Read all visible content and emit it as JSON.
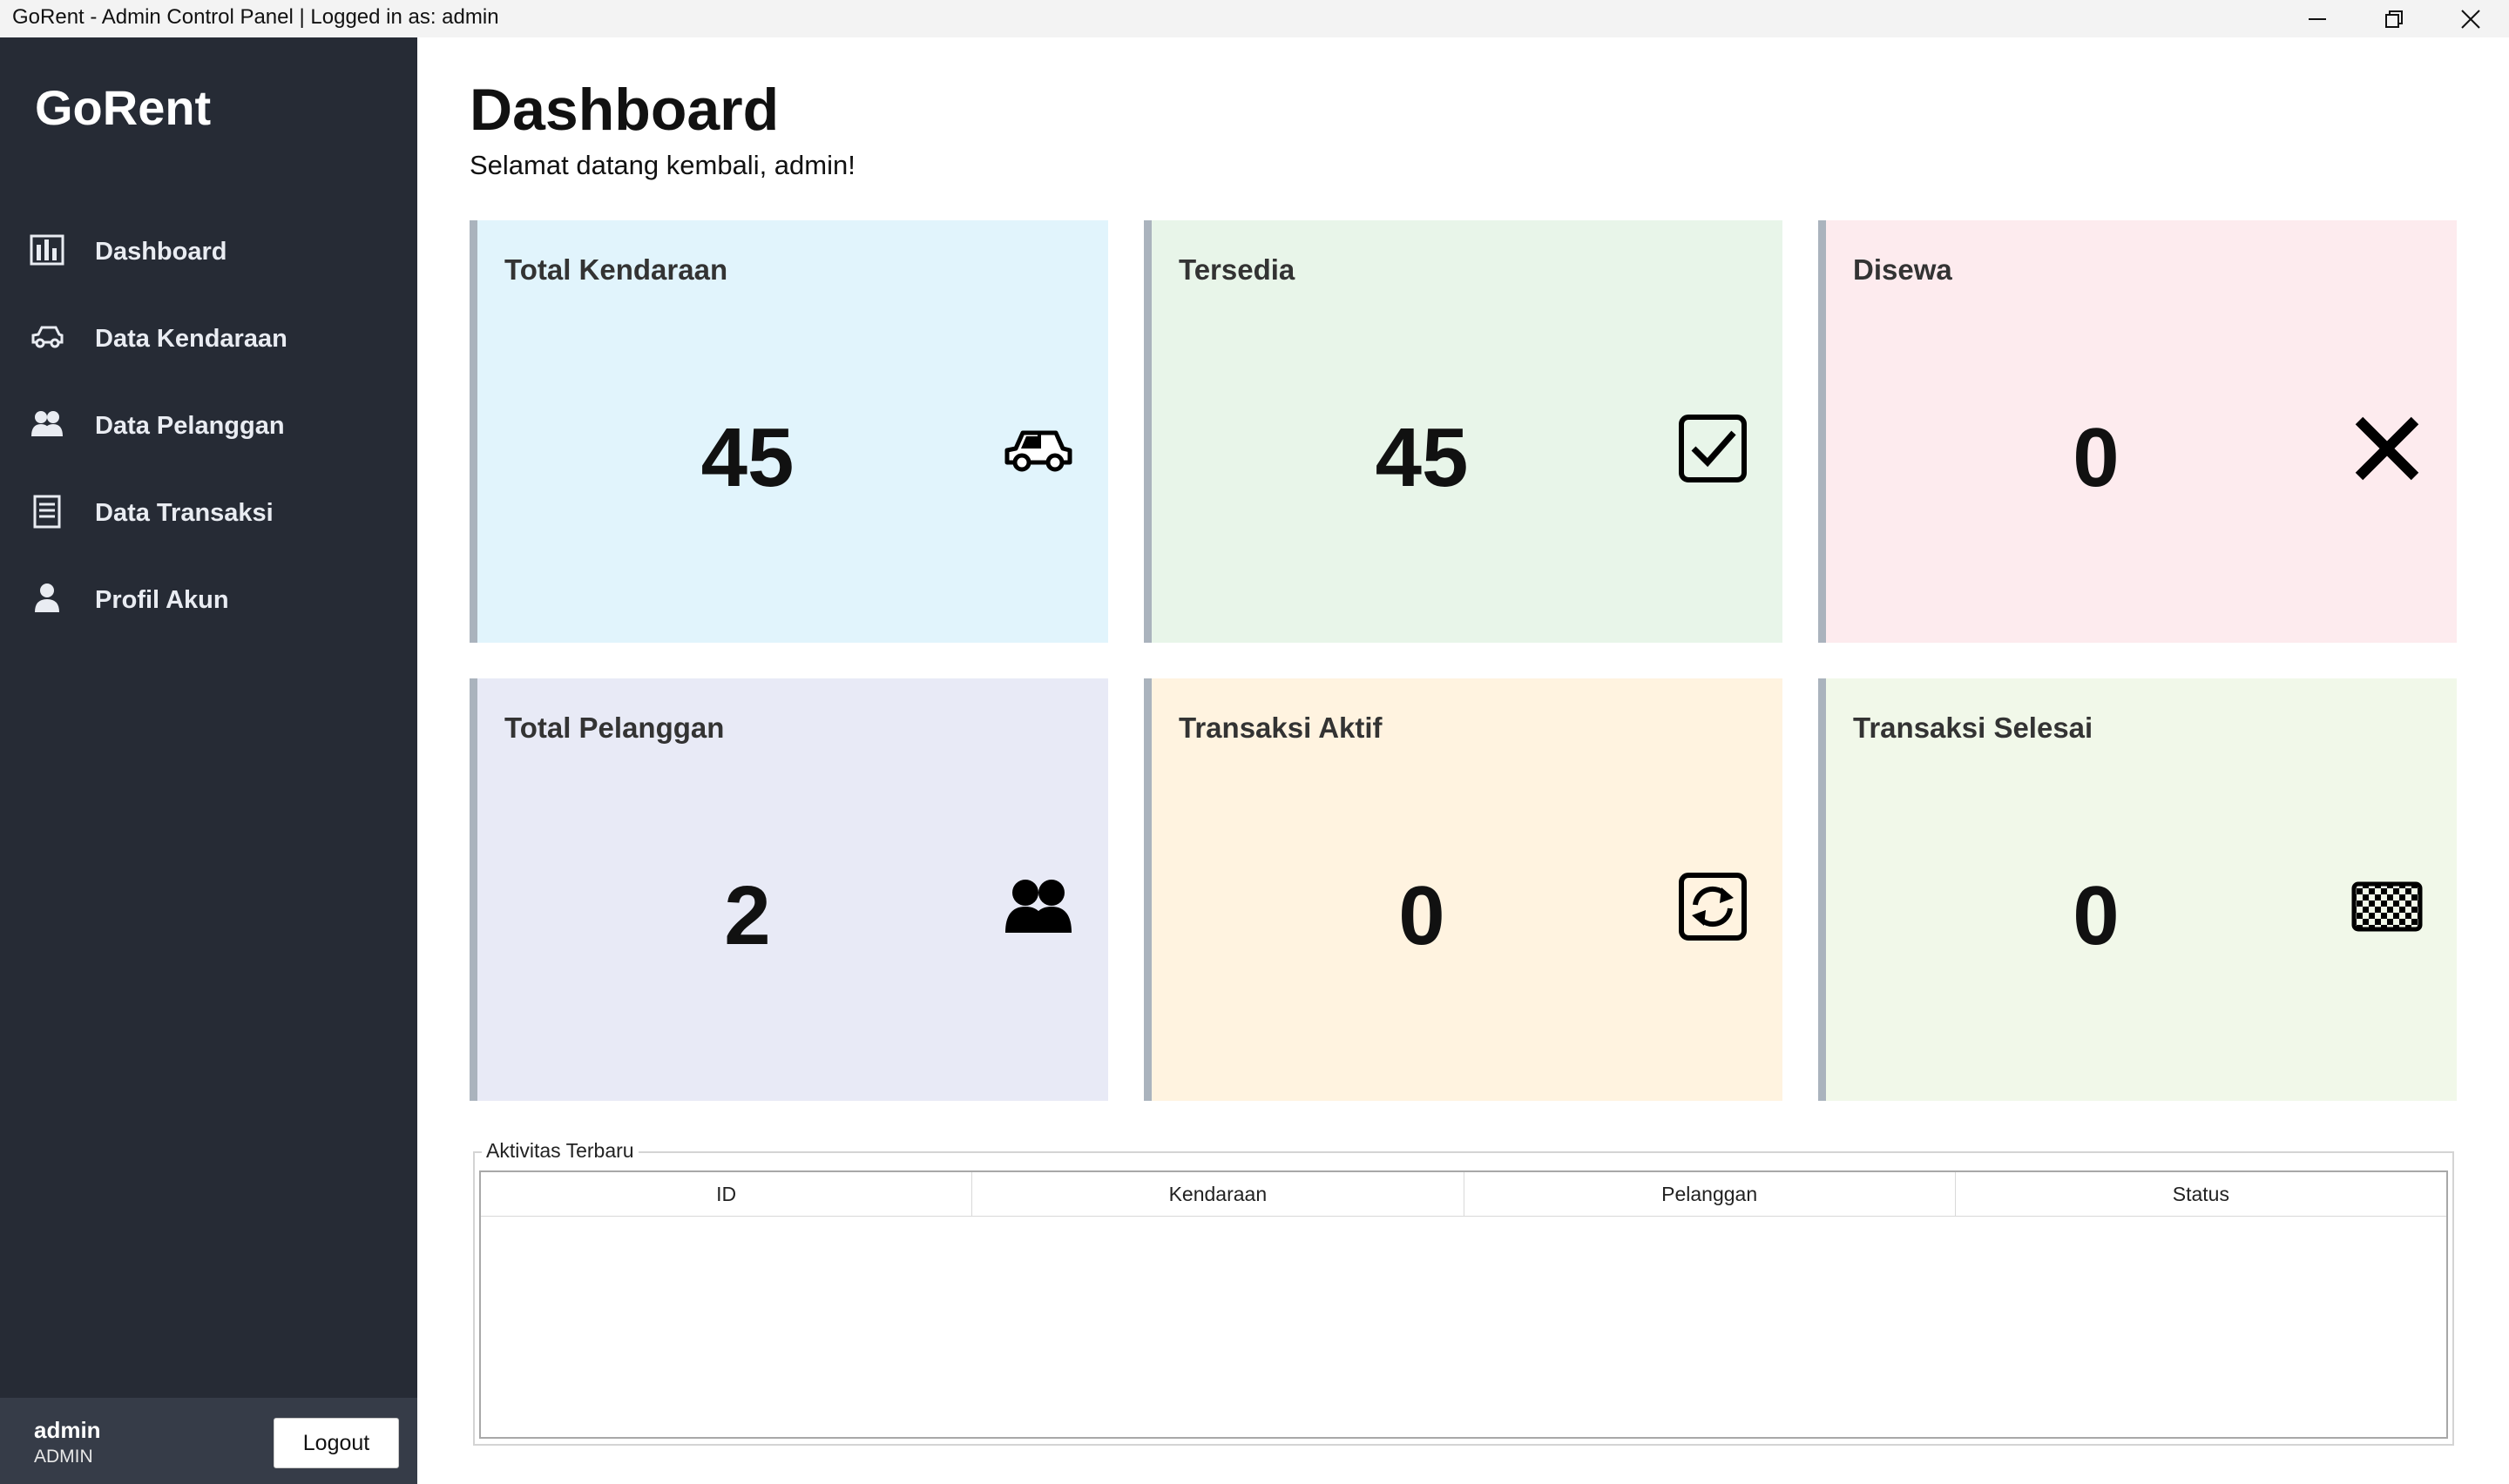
{
  "window": {
    "title": "GoRent - Admin Control Panel | Logged in as: admin",
    "controls": [
      "minimize-icon",
      "restore-icon",
      "close-icon"
    ]
  },
  "sidebar": {
    "brand": "GoRent",
    "items": [
      {
        "label": "Dashboard",
        "icon": "bar-chart-icon"
      },
      {
        "label": "Data Kendaraan",
        "icon": "car-icon"
      },
      {
        "label": "Data Pelanggan",
        "icon": "users-icon"
      },
      {
        "label": "Data Transaksi",
        "icon": "document-icon"
      },
      {
        "label": "Profil Akun",
        "icon": "user-icon"
      }
    ],
    "user": {
      "name": "admin",
      "role": "ADMIN",
      "logout_label": "Logout"
    }
  },
  "header": {
    "title": "Dashboard",
    "welcome": "Selamat datang kembali, admin!"
  },
  "cards": [
    {
      "title": "Total Kendaraan",
      "value": "45",
      "icon": "car-icon",
      "bg": "#e1f4fc"
    },
    {
      "title": "Tersedia",
      "value": "45",
      "icon": "checkbox-icon",
      "bg": "#e8f5e9"
    },
    {
      "title": "Disewa",
      "value": "0",
      "icon": "x-icon",
      "bg": "#fdebee"
    },
    {
      "title": "Total Pelanggan",
      "value": "2",
      "icon": "users-icon",
      "bg": "#e8eaf6"
    },
    {
      "title": "Transaksi Aktif",
      "value": "0",
      "icon": "refresh-icon",
      "bg": "#fff3e0"
    },
    {
      "title": "Transaksi Selesai",
      "value": "0",
      "icon": "checkered-flag-icon",
      "bg": "#f1f8e9"
    }
  ],
  "activity": {
    "legend": "Aktivitas Terbaru",
    "columns": [
      "ID",
      "Kendaraan",
      "Pelanggan",
      "Status"
    ],
    "rows": []
  }
}
